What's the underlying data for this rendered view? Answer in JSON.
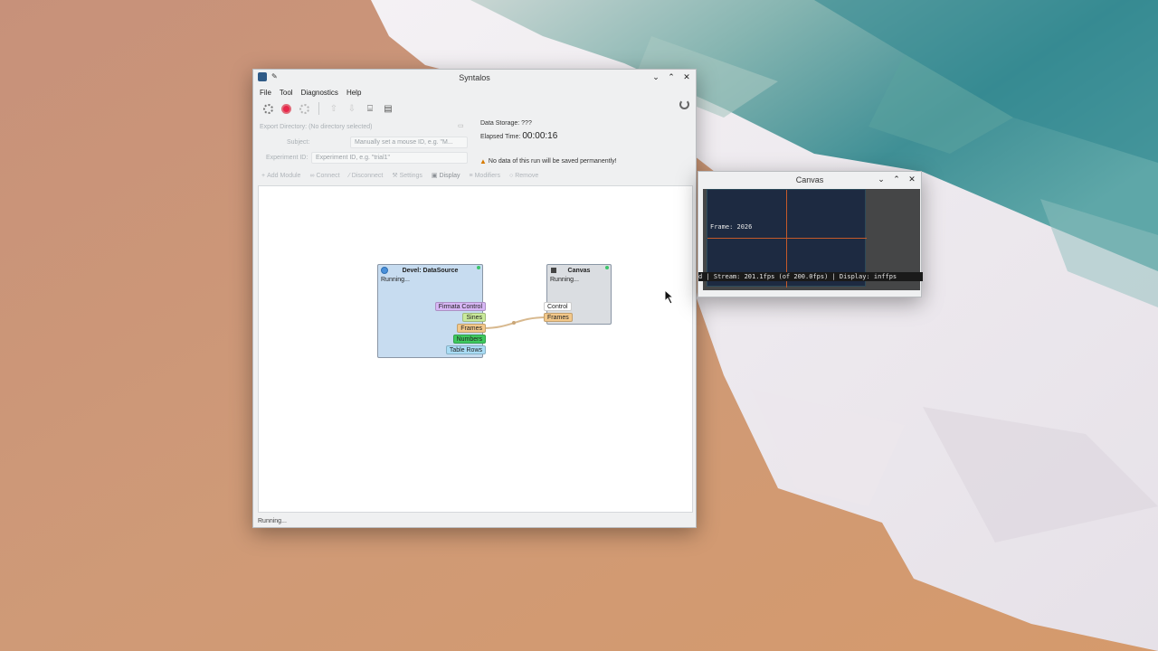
{
  "syntalos": {
    "title": "Syntalos",
    "menu": [
      "File",
      "Tool",
      "Diagnostics",
      "Help"
    ],
    "form": {
      "export_dir_label": "Export Directory:",
      "export_dir_value": "(No directory selected)",
      "subject_label": "Subject:",
      "subject_placeholder": "Manually set a mouse ID, e.g. \"M...",
      "experiment_label": "Experiment ID:",
      "experiment_placeholder": "Experiment ID, e.g. \"trial1\""
    },
    "info": {
      "data_storage_label": "Data Storage:",
      "data_storage_value": "???",
      "elapsed_label": "Elapsed Time:",
      "elapsed_value": "00:00:16",
      "warning": "No data of this run will be saved permanently!"
    },
    "module_toolbar": {
      "add_module": "Add Module",
      "connect": "Connect",
      "disconnect": "Disconnect",
      "settings": "Settings",
      "display": "Display",
      "modifiers": "Modifiers",
      "remove": "Remove"
    },
    "nodes": {
      "datasource": {
        "title": "Devel: DataSource",
        "status": "Running...",
        "ports": [
          {
            "label": "Firmata Control",
            "color": "#d7b6f5"
          },
          {
            "label": "Sines",
            "color": "#c9ea9a"
          },
          {
            "label": "Frames",
            "color": "#f3c88a"
          },
          {
            "label": "Numbers",
            "color": "#3ec95e"
          },
          {
            "label": "Table Rows",
            "color": "#a9dcf5"
          }
        ]
      },
      "canvas": {
        "title": "Canvas",
        "status": "Running...",
        "ports": [
          {
            "label": "Control",
            "color": "#ffffff"
          },
          {
            "label": "Frames",
            "color": "#f3c88a"
          }
        ]
      }
    },
    "statusbar": "Running..."
  },
  "canvas_window": {
    "title": "Canvas",
    "frame_label": "Frame: 2026",
    "stream_line": "d | Stream: 201.1fps (of 200.0fps) | Display: inffps"
  },
  "colors": {
    "accent": "#e8274b",
    "node_datasource": "#c7dcf0",
    "node_canvas": "#dadde1",
    "canvas_frame": "#1d2a41",
    "crosshair": "#c45a2a"
  }
}
